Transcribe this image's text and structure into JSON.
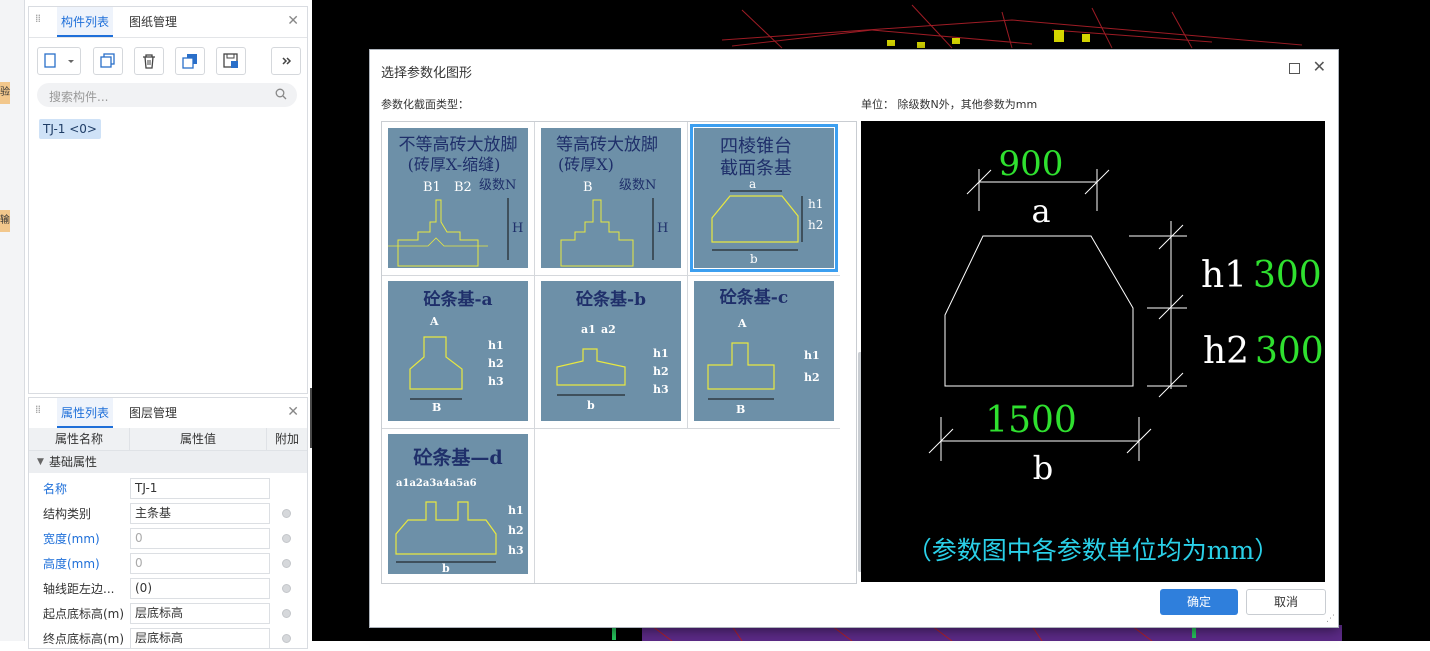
{
  "left_strip": {
    "marks": [
      "验",
      "输"
    ]
  },
  "component_panel": {
    "tabs": [
      "构件列表",
      "图纸管理"
    ],
    "search_placeholder": "搜索构件...",
    "items": [
      "TJ-1 <0>"
    ],
    "toolbar_icons": [
      "new-icon",
      "copy-icon",
      "delete-icon",
      "duplicate-floor-icon",
      "save-icon",
      "more-icon"
    ]
  },
  "property_panel": {
    "tabs": [
      "属性列表",
      "图层管理"
    ],
    "columns": [
      "属性名称",
      "属性值",
      "附加"
    ],
    "group": "基础属性",
    "rows": [
      {
        "name": "名称",
        "value": "TJ-1",
        "blue": true,
        "extra": false
      },
      {
        "name": "结构类别",
        "value": "主条基",
        "blue": false,
        "extra": true
      },
      {
        "name": "宽度(mm)",
        "value": "0",
        "blue": true,
        "extra": true
      },
      {
        "name": "高度(mm)",
        "value": "0",
        "blue": true,
        "extra": true
      },
      {
        "name": "轴线距左边...",
        "value": "(0)",
        "blue": false,
        "extra": true
      },
      {
        "name": "起点底标高(m)",
        "value": "层底标高",
        "blue": false,
        "extra": true
      },
      {
        "name": "终点底标高(m)",
        "value": "层底标高",
        "blue": false,
        "extra": true
      }
    ]
  },
  "dialog": {
    "title": "选择参数化图形",
    "left_label": "参数化截面类型：",
    "right_label": "单位：  除级数N外，其他参数为mm",
    "ok": "确定",
    "cancel": "取消",
    "shapes": [
      {
        "title1": "不等高砖大放脚",
        "title2": "(砖厚X-缩缝)",
        "labels": [
          "B1",
          "B2",
          "级数N",
          "H"
        ],
        "selected": false
      },
      {
        "title1": "等高砖大放脚",
        "title2": "(砖厚X)",
        "labels": [
          "B",
          "级数N",
          "H"
        ],
        "selected": false
      },
      {
        "title1": "四棱锥台",
        "title2": "截面条基",
        "labels": [
          "a",
          "h1",
          "h2",
          "b"
        ],
        "selected": true
      },
      {
        "title1": "砼条基-a",
        "title2": "",
        "labels": [
          "A",
          "h1",
          "h2",
          "h3",
          "B"
        ],
        "selected": false
      },
      {
        "title1": "砼条基-b",
        "title2": "",
        "labels": [
          "a1",
          "a2",
          "h1",
          "h2",
          "h3",
          "b"
        ],
        "selected": false
      },
      {
        "title1": "砼条基-c",
        "title2": "",
        "labels": [
          "A",
          "h1",
          "h2",
          "B"
        ],
        "selected": false
      },
      {
        "title1": "砼条基—d",
        "title2": "",
        "labels": [
          "a1a2a3a4a5a6",
          "h1",
          "h2",
          "h3",
          "b"
        ],
        "selected": false
      }
    ],
    "preview": {
      "a_value": "900",
      "a_label": "a",
      "h1_label": "h1",
      "h1_value": "300",
      "h2_label": "h2",
      "h2_value": "300",
      "b_value": "1500",
      "b_label": "b",
      "note": "（参数图中各参数单位均为mm）"
    }
  }
}
